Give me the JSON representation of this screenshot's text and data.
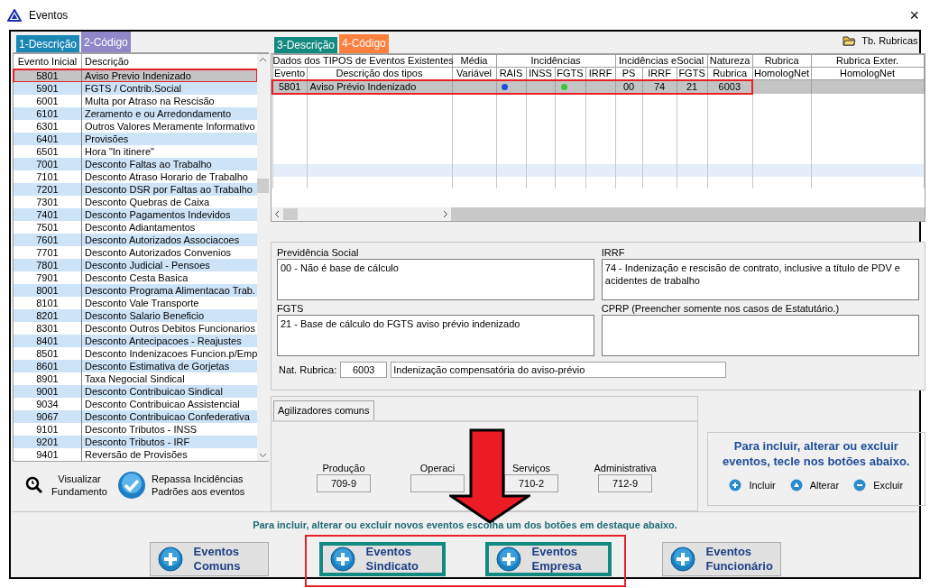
{
  "window": {
    "title": "Eventos",
    "close": "×"
  },
  "left_tabs": [
    {
      "label": "1-Descrição",
      "selected": false,
      "color": "#1b87b5"
    },
    {
      "label": "2-Código",
      "selected": true,
      "color": "#8f87c9"
    }
  ],
  "event_list": {
    "columns": [
      "Evento Inicial",
      "Descrição"
    ],
    "rows": [
      {
        "code": "5801",
        "description": "Aviso Previo Indenizado",
        "selected": true,
        "annotated": true
      },
      {
        "code": "5901",
        "description": "FGTS / Contrib.Social",
        "selected": false,
        "annotated": false
      },
      {
        "code": "6001",
        "description": "Multa por Atraso na Rescisão",
        "selected": false,
        "annotated": false
      },
      {
        "code": "6101",
        "description": "Zeramento e ou Arredondamento",
        "selected": false,
        "annotated": false
      },
      {
        "code": "6301",
        "description": "Outros Valores Meramente Informativo",
        "selected": false,
        "annotated": false
      },
      {
        "code": "6401",
        "description": "Provisões",
        "selected": false,
        "annotated": false
      },
      {
        "code": "6501",
        "description": "Hora \"In itinere\"",
        "selected": false,
        "annotated": false
      },
      {
        "code": "7001",
        "description": "Desconto Faltas ao Trabalho",
        "selected": false,
        "annotated": false
      },
      {
        "code": "7101",
        "description": "Desconto Atraso Horario de Trabalho",
        "selected": false,
        "annotated": false
      },
      {
        "code": "7201",
        "description": "Desconto DSR por Faltas ao Trabalho",
        "selected": false,
        "annotated": false
      },
      {
        "code": "7301",
        "description": "Desconto Quebras de Caixa",
        "selected": false,
        "annotated": false
      },
      {
        "code": "7401",
        "description": "Desconto Pagamentos Indevidos",
        "selected": false,
        "annotated": false
      },
      {
        "code": "7501",
        "description": "Desconto Adiantamentos",
        "selected": false,
        "annotated": false
      },
      {
        "code": "7601",
        "description": "Desconto Autorizados Associacoes",
        "selected": false,
        "annotated": false
      },
      {
        "code": "7701",
        "description": "Desconto Autorizados Convenios",
        "selected": false,
        "annotated": false
      },
      {
        "code": "7801",
        "description": "Desconto Judicial - Pensoes",
        "selected": false,
        "annotated": false
      },
      {
        "code": "7901",
        "description": "Desconto Cesta Basica",
        "selected": false,
        "annotated": false
      },
      {
        "code": "8001",
        "description": "Desconto Programa Alimentacao Trab.",
        "selected": false,
        "annotated": false
      },
      {
        "code": "8101",
        "description": "Desconto Vale Transporte",
        "selected": false,
        "annotated": false
      },
      {
        "code": "8201",
        "description": "Desconto Salario Beneficio",
        "selected": false,
        "annotated": false
      },
      {
        "code": "8301",
        "description": "Desconto Outros Debitos Funcionarios",
        "selected": false,
        "annotated": false
      },
      {
        "code": "8401",
        "description": "Desconto Antecipacoes - Reajustes",
        "selected": false,
        "annotated": false
      },
      {
        "code": "8501",
        "description": "Desconto Indenizacoes Funcion.p/Emp",
        "selected": false,
        "annotated": false
      },
      {
        "code": "8601",
        "description": "Desconto Estimativa de Gorjetas",
        "selected": false,
        "annotated": false
      },
      {
        "code": "8901",
        "description": "Taxa Negocial Sindical",
        "selected": false,
        "annotated": false
      },
      {
        "code": "9001",
        "description": "Desconto Contribuicao Sindical",
        "selected": false,
        "annotated": false
      },
      {
        "code": "9034",
        "description": "Desconto Contribuicao Assistencial",
        "selected": false,
        "annotated": false
      },
      {
        "code": "9067",
        "description": "Desconto Contribuicao Confederativa",
        "selected": false,
        "annotated": false
      },
      {
        "code": "9101",
        "description": "Desconto Tributos - INSS",
        "selected": false,
        "annotated": false
      },
      {
        "code": "9201",
        "description": "Desconto Tributos - IRF",
        "selected": false,
        "annotated": false
      },
      {
        "code": "9401",
        "description": "Reversão de Provisões",
        "selected": false,
        "annotated": false
      }
    ]
  },
  "left_actions": [
    {
      "kind": "view",
      "lines": [
        "Visualizar",
        "Fundamento"
      ]
    },
    {
      "kind": "check",
      "lines": [
        "Repassa Incidências",
        "Padrões aos eventos"
      ]
    }
  ],
  "right_tabs": [
    {
      "label": "3-Descrição",
      "selected": false,
      "color": "#138a80"
    },
    {
      "label": "4-Código",
      "selected": true,
      "color": "#ff7f3f"
    }
  ],
  "rubricas_button": "Tb. Rubricas",
  "types_table": {
    "groups": [
      "Dados dos TIPOS de Eventos Existentes",
      "Média",
      "Incidências",
      "Incidências eSocial",
      "Natureza",
      "Rubrica",
      "Rubrica Exter."
    ],
    "columns": [
      "Evento",
      "Descrição dos tipos",
      "Variável",
      "RAIS",
      "INSS",
      "FGTS",
      "IRRF",
      "PS",
      "IRRF",
      "FGTS",
      "Rubrica",
      "HomologNet",
      "HomologNet"
    ],
    "rows": [
      {
        "selected": true,
        "annotated": true,
        "evento": "5801",
        "descricao": "Aviso Prévio Indenizado",
        "incidencias": [
          {
            "checked": true,
            "color": "#1f4fe0"
          },
          {
            "checked": false
          },
          {
            "checked": true,
            "color": "#3cc43c"
          },
          {
            "checked": false
          }
        ],
        "ps": "00",
        "irrf": "74",
        "fgts": "21",
        "rubrica": "6003"
      }
    ]
  },
  "codes": [
    {
      "label": "Previdência Social",
      "value": "00 - Não é base de cálculo"
    },
    {
      "label": "IRRF",
      "value": "74 - Indenização e rescisão de contrato, inclusive a título de PDV e acidentes de trabalho"
    },
    {
      "label": "FGTS",
      "value": "21 - Base de cálculo do FGTS aviso prévio indenizado"
    },
    {
      "label": "CPRP (Preencher somente nos casos de Estatutário.)"
    }
  ],
  "nat_rubrica": {
    "label": "Nat. Rubrica:",
    "code": "6003",
    "description": "Indenização compensatória do aviso-prévio"
  },
  "agilizadores": {
    "tab": "Agilizadores comuns",
    "fields": [
      {
        "label": "Produção",
        "value": "709-9"
      },
      {
        "label": "Operaci"
      },
      {
        "label": "Serviços",
        "value": "710-2"
      },
      {
        "label": "Administrativa",
        "value": "712-9"
      }
    ]
  },
  "hint_box": {
    "text": "Para incluir, alterar ou excluir eventos, tecle nos botões abaixo.",
    "actions": [
      {
        "kind": "add",
        "label": "Incluir"
      },
      {
        "kind": "edit",
        "label": "Alterar"
      },
      {
        "kind": "remove",
        "label": "Excluir"
      }
    ]
  },
  "bottom_message": "Para incluir, alterar ou excluir novos eventos escolha um dos botões em destaque abaixo.",
  "event_buttons": [
    {
      "lines": [
        "Eventos",
        "Comuns"
      ],
      "highlighted": false,
      "annotated": false
    },
    {
      "lines": [
        "Eventos",
        "Sindicato"
      ],
      "highlighted": true,
      "annotated": true
    },
    {
      "lines": [
        "Eventos",
        "Empresa"
      ],
      "highlighted": true,
      "annotated": true
    },
    {
      "lines": [
        "Eventos",
        "Funcionário"
      ],
      "highlighted": false,
      "annotated": false
    }
  ]
}
